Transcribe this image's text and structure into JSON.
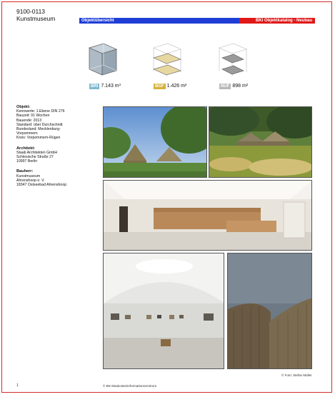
{
  "header": {
    "id": "9100-0113",
    "title": "Kunstmuseum",
    "bar_left": "Objektübersicht",
    "bar_right": "BKI Objektkatalog - Neubau",
    "colors": {
      "blue": "#1f3ed6",
      "red": "#e01818"
    }
  },
  "metrics": [
    {
      "tag": "BRI",
      "value": "7.143 m³",
      "color": "#7fb9cf"
    },
    {
      "tag": "BGF",
      "value": "1.426 m²",
      "color": "#d2b23c"
    },
    {
      "tag": "NUF",
      "value": "898 m²",
      "color": "#b9b9b9"
    }
  ],
  "objekt": {
    "heading": "Objekt:",
    "lines": [
      "Kennwerte: 1.Ebene DIN 276",
      "Bauzeit: 91 Wochen",
      "Bauende: 2013",
      "Standard: über Durchschnitt",
      "Bundesland: Mecklenburg-",
      "Vorpommern",
      "Kreis: Vorpommern-Rügen"
    ]
  },
  "architekt": {
    "heading": "Architekt:",
    "lines": [
      "Staab Architekten GmbH",
      "Schlesische Straße 27",
      "10997 Berlin"
    ]
  },
  "bauherr": {
    "heading": "Bauherr:",
    "lines": [
      "Kunstmuseum",
      "Ahrenshoop e. V.",
      "18347 Ostseebad Ahrenshoop"
    ]
  },
  "photos": [
    {
      "name": "photo-exterior-trees"
    },
    {
      "name": "photo-exterior-field"
    },
    {
      "name": "photo-interior-foyer"
    },
    {
      "name": "photo-interior-gallery"
    },
    {
      "name": "photo-exterior-facade"
    }
  ],
  "footer": {
    "page": "1",
    "copyright": "© BKI Baukosteninformationszentrum",
    "credit": "© Foto: Stefan Müller"
  }
}
